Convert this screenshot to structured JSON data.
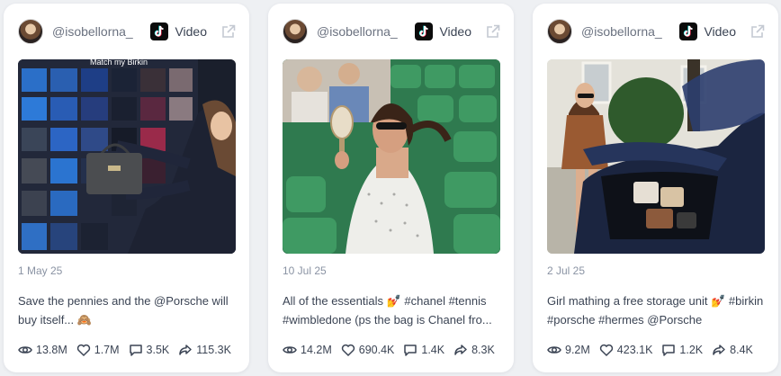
{
  "cards": [
    {
      "handle": "@isobellorna_",
      "platform": "Video",
      "image_overlay_text": "Match my Birkin",
      "date": "1 May 25",
      "caption": "Save the pennies and the @Porsche will buy itself... 🙈",
      "stats": {
        "views": "13.8M",
        "likes": "1.7M",
        "comments": "3.5K",
        "shares": "115.3K"
      }
    },
    {
      "handle": "@isobellorna_",
      "platform": "Video",
      "date": "10 Jul 25",
      "caption": "All of the essentials 💅 #chanel #tennis #wimbledone (ps the bag is Chanel fro...",
      "stats": {
        "views": "14.2M",
        "likes": "690.4K",
        "comments": "1.4K",
        "shares": "8.3K"
      }
    },
    {
      "handle": "@isobellorna_",
      "platform": "Video",
      "date": "2 Jul 25",
      "caption": "Girl mathing a free storage unit 💅 #birkin #porsche #hermes @Porsche",
      "stats": {
        "views": "9.2M",
        "likes": "423.1K",
        "comments": "1.2K",
        "shares": "8.4K"
      }
    }
  ],
  "icons": {
    "platform": "tiktok-icon",
    "external": "external-link-icon",
    "views": "eye-icon",
    "likes": "heart-icon",
    "comments": "comment-icon",
    "shares": "share-icon"
  },
  "colors": {
    "background": "#eef0f3",
    "card": "#ffffff",
    "text": "#3b4454",
    "muted": "#8a93a3"
  }
}
